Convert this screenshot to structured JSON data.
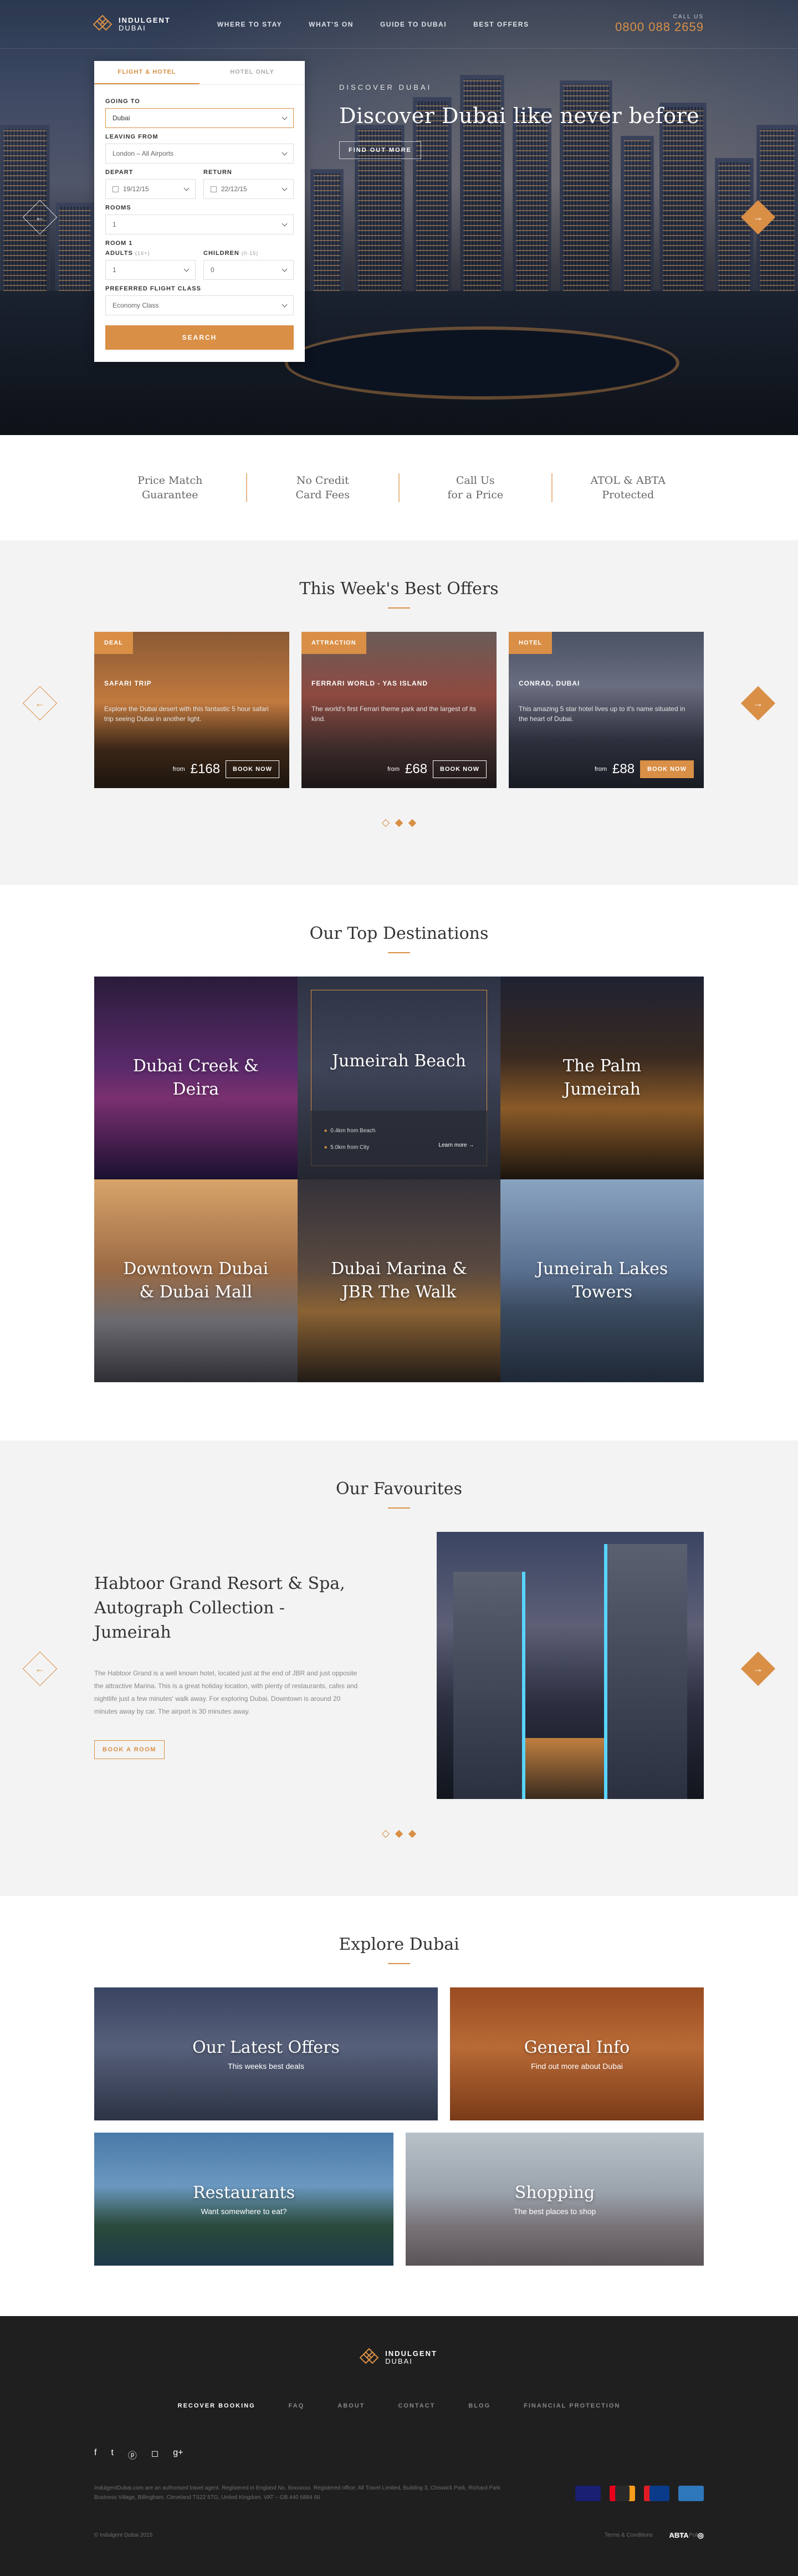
{
  "brand": {
    "line1": "INDULGENT",
    "line2": "DUBAI"
  },
  "nav": {
    "items": [
      "WHERE TO STAY",
      "WHAT'S ON",
      "GUIDE TO DUBAI",
      "BEST OFFERS"
    ],
    "call_label": "CALL US",
    "phone": "0800 088 2659"
  },
  "booking": {
    "tabs": [
      "FLIGHT & HOTEL",
      "HOTEL ONLY"
    ],
    "going_to_label": "GOING TO",
    "going_to_value": "Dubai",
    "leaving_label": "LEAVING FROM",
    "leaving_value": "London – All Airports",
    "depart_label": "DEPART",
    "depart_value": "19/12/15",
    "return_label": "RETURN",
    "return_value": "22/12/15",
    "rooms_label": "ROOMS",
    "rooms_value": "1",
    "room1_label": "ROOM 1",
    "adults_label": "ADULTS",
    "adults_hint": "(16+)",
    "adults_value": "1",
    "children_label": "CHILDREN",
    "children_hint": "(0-15)",
    "children_value": "0",
    "class_label": "PREFERRED FLIGHT CLASS",
    "class_value": "Economy Class",
    "search": "SEARCH"
  },
  "hero": {
    "kicker": "DISCOVER DUBAI",
    "title": "Discover Dubai like never before",
    "cta": "FIND OUT MORE"
  },
  "usp": [
    {
      "l1": "Price Match",
      "l2": "Guarantee"
    },
    {
      "l1": "No Credit",
      "l2": "Card Fees"
    },
    {
      "l1": "Call Us",
      "l2": "for a Price"
    },
    {
      "l1": "ATOL & ABTA",
      "l2": "Protected"
    }
  ],
  "offers": {
    "title": "This Week's Best Offers",
    "items": [
      {
        "badge": "DEAL",
        "name": "SAFARI TRIP",
        "desc": "Explore the Dubai desert with this fantastic 5 hour safari trip seeing Dubai in another light.",
        "from": "from",
        "price": "£168",
        "cta": "BOOK NOW"
      },
      {
        "badge": "ATTRACTION",
        "name": "FERRARI WORLD - YAS ISLAND",
        "desc": "The world's first Ferrari theme park and the largest of its kind.",
        "from": "from",
        "price": "£68",
        "cta": "BOOK NOW"
      },
      {
        "badge": "HOTEL",
        "name": "CONRAD, DUBAI",
        "desc": "This amazing 5 star hotel lives up to it's name situated in the heart of Dubai.",
        "from": "from",
        "price": "£88",
        "cta": "BOOK NOW"
      }
    ]
  },
  "destinations": {
    "title": "Our Top Destinations",
    "items": [
      "Dubai Creek & Deira",
      "Jumeirah Beach",
      "The Palm Jumeirah",
      "Downtown Dubai & Dubai Mall",
      "Dubai Marina & JBR The Walk",
      "Jumeirah Lakes Towers"
    ],
    "meta1": "0.4km from Beach",
    "meta2": "5.0km from City",
    "learn": "Learn more →"
  },
  "favourites": {
    "title": "Our Favourites",
    "hotel": "Habtoor Grand Resort & Spa, Autograph Collection - Jumeirah",
    "desc": "The Habtoor Grand is a well known hotel, located just at the end of JBR and just opposite the attractive Marina. This is a great holiday location, with plenty of restaurants, cafes and nightlife just a few minutes' walk away. For exploring Dubai, Downtown is around 20 minutes away by car. The airport is 30 minutes away.",
    "cta": "BOOK A ROOM"
  },
  "explore": {
    "title": "Explore Dubai",
    "tiles": [
      {
        "t": "Our Latest Offers",
        "s": "This weeks best deals"
      },
      {
        "t": "General Info",
        "s": "Find out more about Dubai"
      },
      {
        "t": "Restaurants",
        "s": "Want somewhere to eat?"
      },
      {
        "t": "Shopping",
        "s": "The best places to shop"
      }
    ]
  },
  "footer": {
    "links": [
      "RECOVER BOOKING",
      "FAQ",
      "ABOUT",
      "CONTACT",
      "BLOG",
      "FINANCIAL PROTECTION"
    ],
    "legal": "IndulgentDubai.com are an authorised travel agent. Registered in England No. 8xxxxxxx. Registered office: All Travel Limited, Building 3, Chiswick Park, Richard Park Business Village, Billingham, Cleveland TS22 5TG, United Kingdom. VAT – GB 440 6884 66",
    "copyright": "© Indulgent Dubai 2015",
    "terms": "Terms & Conditions",
    "privacy": "Privacy Policy",
    "abta": "ABTA"
  }
}
